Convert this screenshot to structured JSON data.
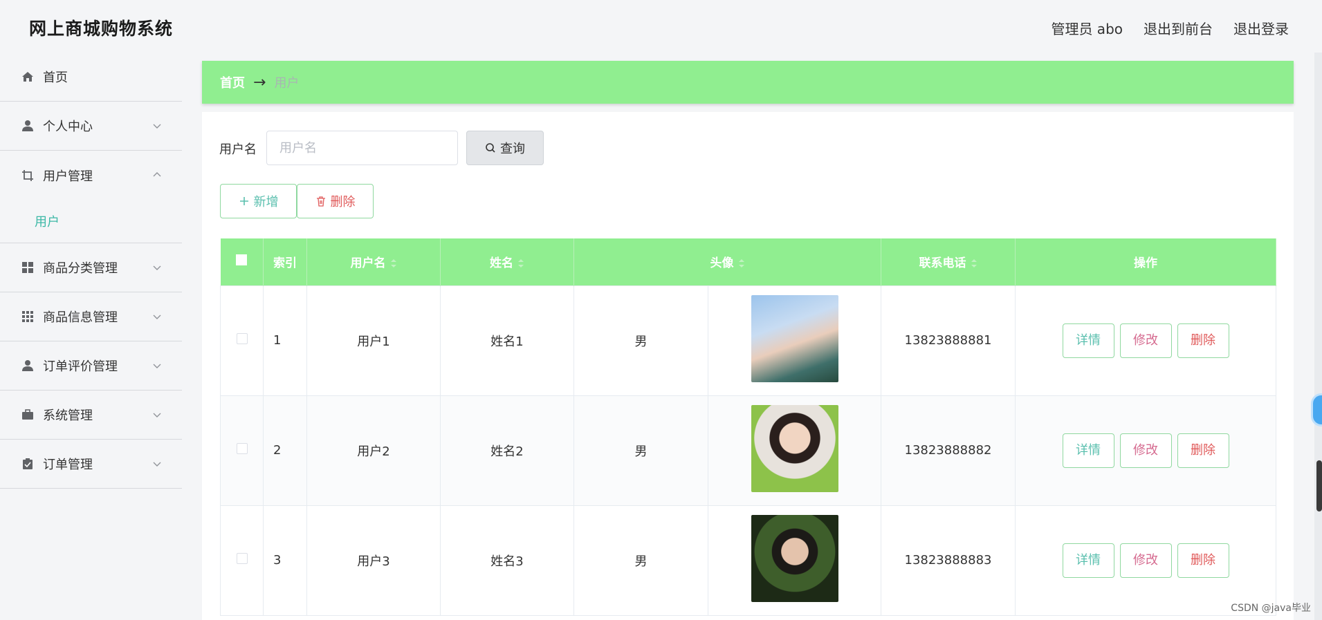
{
  "header": {
    "title": "网上商城购物系统",
    "links": [
      "管理员 abo",
      "退出到前台",
      "退出登录"
    ]
  },
  "sidebar": {
    "items": [
      {
        "label": "首页",
        "icon": "home-icon"
      },
      {
        "label": "个人中心",
        "icon": "user-icon"
      },
      {
        "label": "用户管理",
        "icon": "crop-icon",
        "expanded": true,
        "children": [
          "用户"
        ]
      },
      {
        "label": "商品分类管理",
        "icon": "grid-icon"
      },
      {
        "label": "商品信息管理",
        "icon": "apps-icon"
      },
      {
        "label": "订单评价管理",
        "icon": "user-icon"
      },
      {
        "label": "系统管理",
        "icon": "briefcase-icon"
      },
      {
        "label": "订单管理",
        "icon": "clipboard-icon"
      }
    ]
  },
  "breadcrumb": {
    "home": "首页",
    "arrow": "→",
    "current": "用户"
  },
  "search": {
    "label": "用户名",
    "placeholder": "用户名",
    "button": "查询"
  },
  "actions": {
    "add": "新增",
    "delete": "删除"
  },
  "table": {
    "columns": [
      "索引",
      "用户名",
      "姓名",
      "头像",
      "联系电话",
      "操作"
    ],
    "rows": [
      {
        "index": "1",
        "username": "用户1",
        "name": "姓名1",
        "gender": "男",
        "phone": "13823888881"
      },
      {
        "index": "2",
        "username": "用户2",
        "name": "姓名2",
        "gender": "男",
        "phone": "13823888882"
      },
      {
        "index": "3",
        "username": "用户3",
        "name": "姓名3",
        "gender": "男",
        "phone": "13823888883"
      }
    ],
    "row_actions": {
      "detail": "详情",
      "edit": "修改",
      "delete": "删除"
    }
  },
  "watermark": "CSDN @java毕业",
  "colors": {
    "accent_green": "#90ee90",
    "teal_text": "#3cb8a6",
    "red_text": "#e05a5a",
    "pink_text": "#d56a8f"
  }
}
